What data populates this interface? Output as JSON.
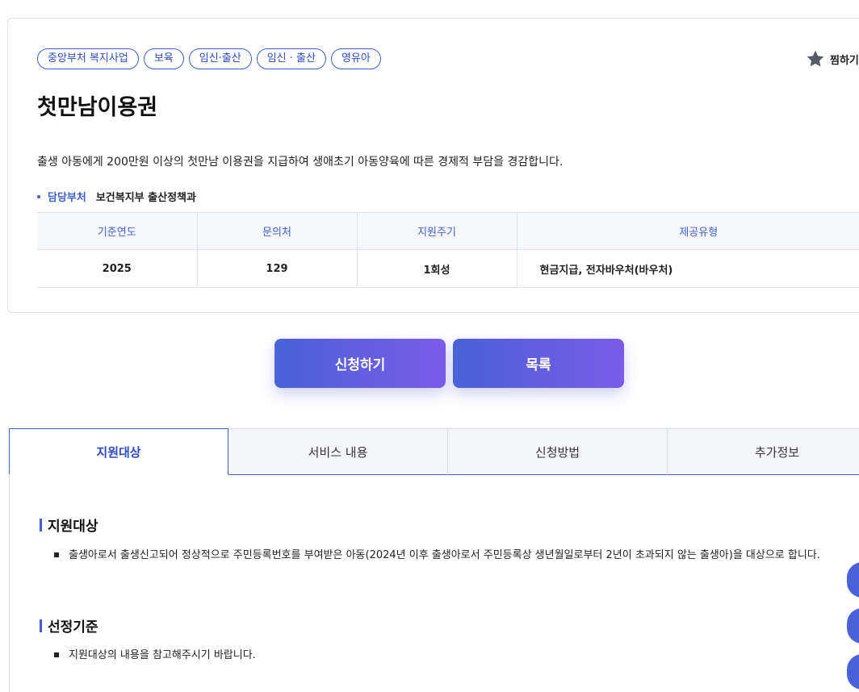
{
  "tags": [
    "중앙부처 복지사업",
    "보육",
    "임신·출산",
    "임신 · 출산",
    "영유아"
  ],
  "favorite_label": "찜하기",
  "title": "첫만남이용권",
  "description": "출생 아동에게 200만원 이상의 첫만남 이용권을 지급하여 생애초기 아동양육에 따른 경제적 부담을 경감합니다.",
  "department": {
    "label": "담당부처",
    "value": "보건복지부 출산정책과"
  },
  "info_table": {
    "headers": [
      "기준연도",
      "문의처",
      "지원주기",
      "제공유형"
    ],
    "values": [
      "2025",
      "129",
      "1회성",
      "현금지급, 전자바우처(바우처)"
    ]
  },
  "buttons": {
    "apply": "신청하기",
    "list": "목록"
  },
  "tabs": [
    "지원대상",
    "서비스 내용",
    "신청방법",
    "추가정보"
  ],
  "sections": [
    {
      "title": "지원대상",
      "items": [
        "출생아로서 출생신고되어 정상적으로 주민등록번호를 부여받은 아동(2024년 이후 출생아로서 주민등록상 생년월일로부터 2년이 초과되지 않는 출생아)을 대상으로 합니다."
      ]
    },
    {
      "title": "선정기준",
      "items": [
        "지원대상의 내용을 참고해주시기 바랍니다."
      ]
    }
  ],
  "colors": {
    "accent": "#3f5fd0",
    "button_start": "#4a62d8",
    "button_end": "#7a5ce8"
  },
  "icons": {
    "favorite": "star-icon"
  }
}
